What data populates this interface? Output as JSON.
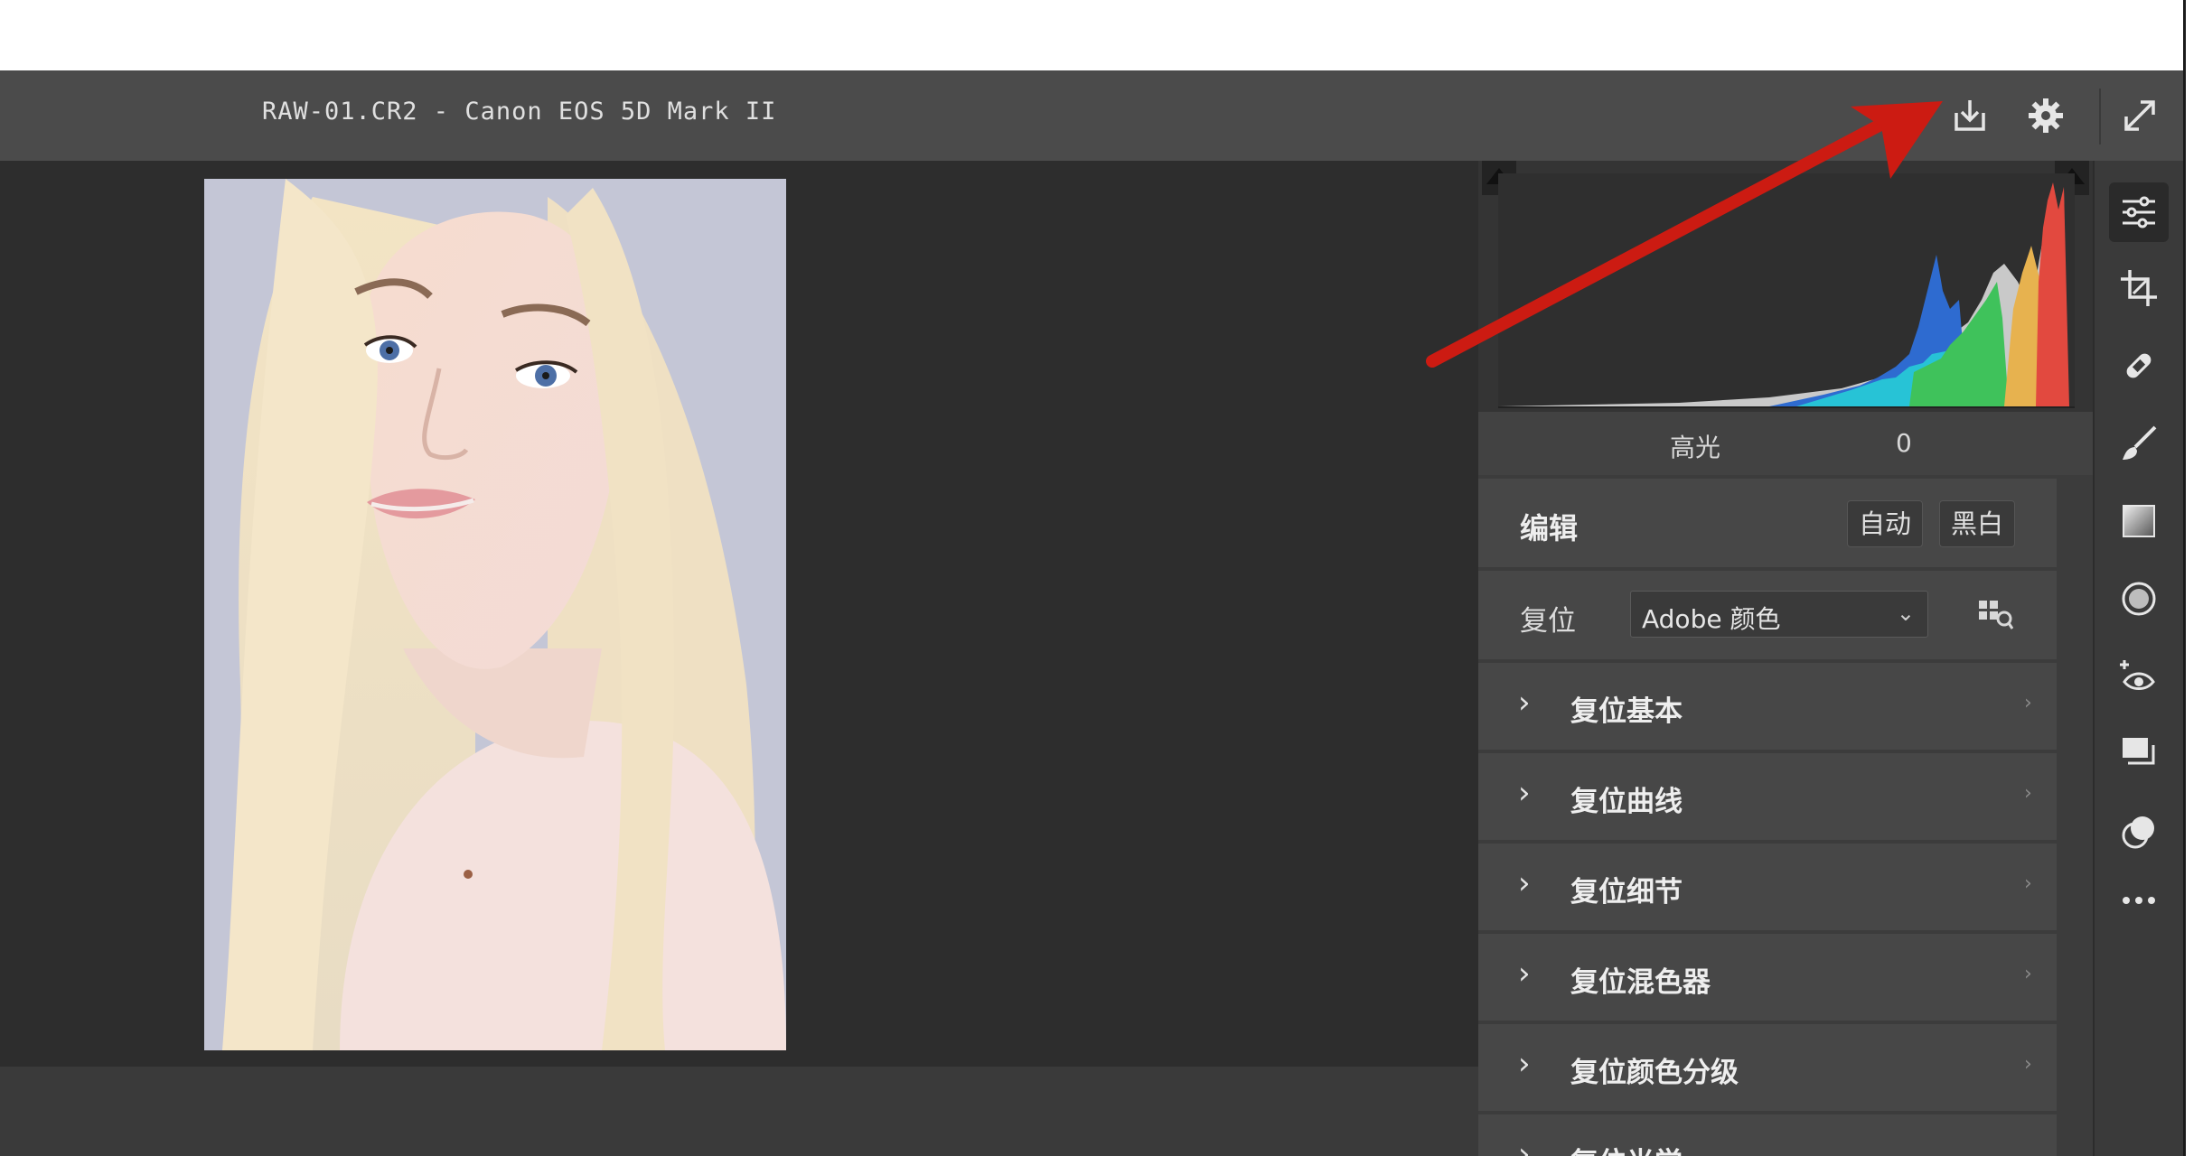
{
  "window": {
    "file_label": "RAW-01.CR2 -  Canon EOS 5D Mark II"
  },
  "toolbar_top": {
    "save_icon": "save-icon",
    "settings_icon": "gear-icon",
    "fullscreen_icon": "fullscreen-icon"
  },
  "histogram": {
    "readout_label": "高光",
    "readout_value": "0"
  },
  "edit": {
    "title": "编辑",
    "auto_label": "自动",
    "bw_label": "黑白"
  },
  "preset": {
    "label": "复位",
    "profile_value": "Adobe 颜色"
  },
  "sections": [
    {
      "label": "复位基本"
    },
    {
      "label": "复位曲线"
    },
    {
      "label": "复位细节"
    },
    {
      "label": "复位混色器"
    },
    {
      "label": "复位颜色分级"
    },
    {
      "label": "复位光学"
    }
  ],
  "side_tools": [
    "edit-icon",
    "crop-icon",
    "heal-icon",
    "brush-icon",
    "gradient-icon",
    "radial-icon",
    "redeye-icon",
    "snapshot-icon",
    "presets-icon",
    "more-icon"
  ],
  "colors": {
    "annotation_arrow": "#cc1b12",
    "panel_bg": "#474747",
    "canvas_bg": "#2d2d2d"
  }
}
